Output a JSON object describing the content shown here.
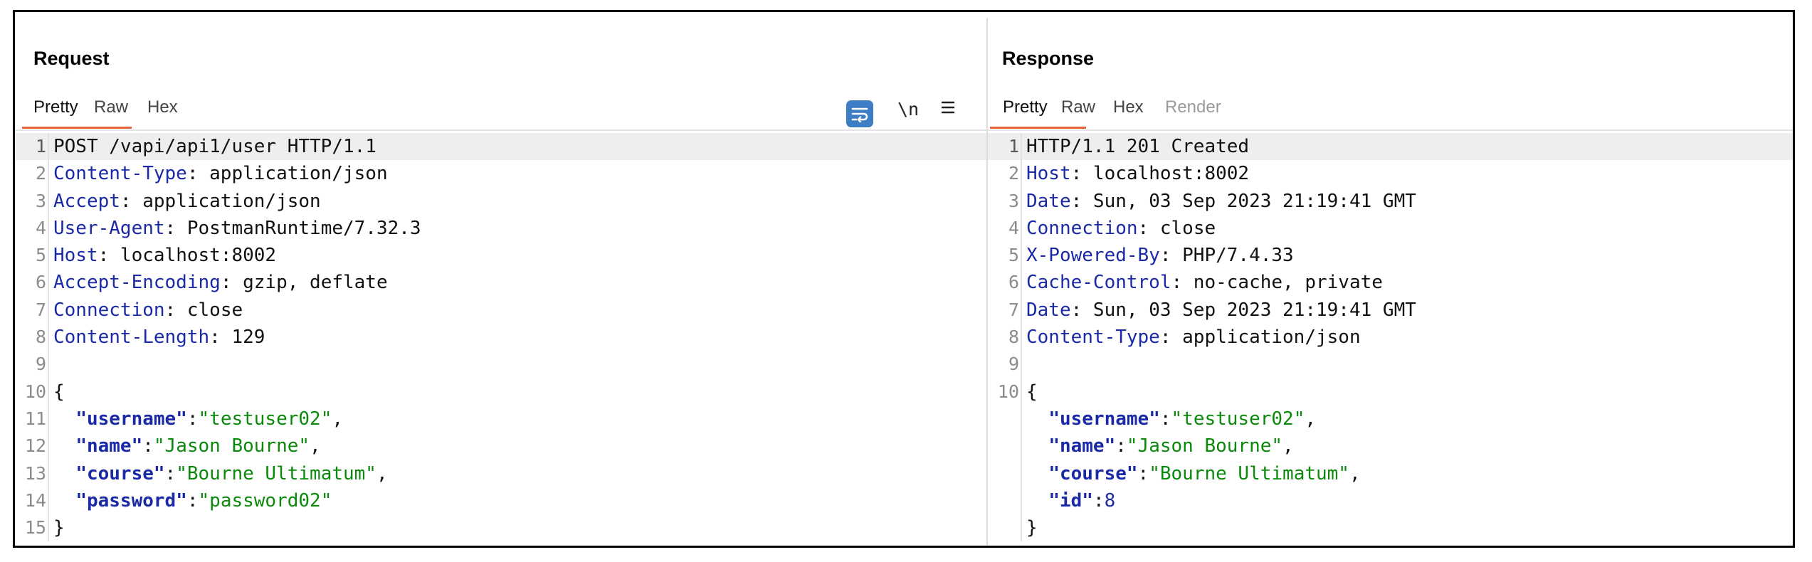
{
  "request": {
    "title": "Request",
    "tabs": [
      "Pretty",
      "Raw",
      "Hex"
    ],
    "active_tab": "Pretty",
    "toolbar": {
      "wrap_icon": "wrap-lines-icon",
      "newline_label": "\\n",
      "menu_icon": "hamburger-menu-icon"
    },
    "lines": [
      {
        "n": "1",
        "parts": [
          [
            "POST /vapi/api1/user HTTP/1.1",
            "plain"
          ]
        ]
      },
      {
        "n": "2",
        "parts": [
          [
            "Content-Type",
            "hk"
          ],
          [
            ": application/json",
            "plain"
          ]
        ]
      },
      {
        "n": "3",
        "parts": [
          [
            "Accept",
            "hk"
          ],
          [
            ": application/json",
            "plain"
          ]
        ]
      },
      {
        "n": "4",
        "parts": [
          [
            "User-Agent",
            "hk"
          ],
          [
            ": PostmanRuntime/7.32.3",
            "plain"
          ]
        ]
      },
      {
        "n": "5",
        "parts": [
          [
            "Host",
            "hk"
          ],
          [
            ": localhost:8002",
            "plain"
          ]
        ]
      },
      {
        "n": "6",
        "parts": [
          [
            "Accept-Encoding",
            "hk"
          ],
          [
            ": gzip, deflate",
            "plain"
          ]
        ]
      },
      {
        "n": "7",
        "parts": [
          [
            "Connection",
            "hk"
          ],
          [
            ": close",
            "plain"
          ]
        ]
      },
      {
        "n": "8",
        "parts": [
          [
            "Content-Length",
            "hk"
          ],
          [
            ": 129",
            "plain"
          ]
        ]
      },
      {
        "n": "9",
        "parts": []
      },
      {
        "n": "10",
        "parts": [
          [
            "{",
            "plain"
          ]
        ]
      },
      {
        "n": "11",
        "parts": [
          [
            "  ",
            "plain"
          ],
          [
            "\"username\"",
            "jk"
          ],
          [
            ":",
            "plain"
          ],
          [
            "\"testuser02\"",
            "js"
          ],
          [
            ",",
            "plain"
          ]
        ]
      },
      {
        "n": "12",
        "parts": [
          [
            "  ",
            "plain"
          ],
          [
            "\"name\"",
            "jk"
          ],
          [
            ":",
            "plain"
          ],
          [
            "\"Jason Bourne\"",
            "js"
          ],
          [
            ",",
            "plain"
          ]
        ]
      },
      {
        "n": "13",
        "parts": [
          [
            "  ",
            "plain"
          ],
          [
            "\"course\"",
            "jk"
          ],
          [
            ":",
            "plain"
          ],
          [
            "\"Bourne Ultimatum\"",
            "js"
          ],
          [
            ",",
            "plain"
          ]
        ]
      },
      {
        "n": "14",
        "parts": [
          [
            "  ",
            "plain"
          ],
          [
            "\"password\"",
            "jk"
          ],
          [
            ":",
            "plain"
          ],
          [
            "\"password02\"",
            "js"
          ]
        ]
      },
      {
        "n": "15",
        "parts": [
          [
            "}",
            "plain"
          ]
        ]
      }
    ]
  },
  "response": {
    "title": "Response",
    "tabs": [
      "Pretty",
      "Raw",
      "Hex",
      "Render"
    ],
    "active_tab": "Pretty",
    "disabled_tabs": [
      "Render"
    ],
    "lines": [
      {
        "n": "1",
        "parts": [
          [
            "HTTP/1.1 201 Created",
            "plain"
          ]
        ]
      },
      {
        "n": "2",
        "parts": [
          [
            "Host",
            "hk"
          ],
          [
            ": localhost:8002",
            "plain"
          ]
        ]
      },
      {
        "n": "3",
        "parts": [
          [
            "Date",
            "hk"
          ],
          [
            ": Sun, 03 Sep 2023 21:19:41 GMT",
            "plain"
          ]
        ]
      },
      {
        "n": "4",
        "parts": [
          [
            "Connection",
            "hk"
          ],
          [
            ": close",
            "plain"
          ]
        ]
      },
      {
        "n": "5",
        "parts": [
          [
            "X-Powered-By",
            "hk"
          ],
          [
            ": PHP/7.4.33",
            "plain"
          ]
        ]
      },
      {
        "n": "6",
        "parts": [
          [
            "Cache-Control",
            "hk"
          ],
          [
            ": no-cache, private",
            "plain"
          ]
        ]
      },
      {
        "n": "7",
        "parts": [
          [
            "Date",
            "hk"
          ],
          [
            ": Sun, 03 Sep 2023 21:19:41 GMT",
            "plain"
          ]
        ]
      },
      {
        "n": "8",
        "parts": [
          [
            "Content-Type",
            "hk"
          ],
          [
            ": application/json",
            "plain"
          ]
        ]
      },
      {
        "n": "9",
        "parts": []
      },
      {
        "n": "10",
        "parts": [
          [
            "{",
            "plain"
          ]
        ]
      },
      {
        "n": "",
        "parts": [
          [
            "  ",
            "plain"
          ],
          [
            "\"username\"",
            "jk"
          ],
          [
            ":",
            "plain"
          ],
          [
            "\"testuser02\"",
            "js"
          ],
          [
            ",",
            "plain"
          ]
        ]
      },
      {
        "n": "",
        "parts": [
          [
            "  ",
            "plain"
          ],
          [
            "\"name\"",
            "jk"
          ],
          [
            ":",
            "plain"
          ],
          [
            "\"Jason Bourne\"",
            "js"
          ],
          [
            ",",
            "plain"
          ]
        ]
      },
      {
        "n": "",
        "parts": [
          [
            "  ",
            "plain"
          ],
          [
            "\"course\"",
            "jk"
          ],
          [
            ":",
            "plain"
          ],
          [
            "\"Bourne Ultimatum\"",
            "js"
          ],
          [
            ",",
            "plain"
          ]
        ]
      },
      {
        "n": "",
        "parts": [
          [
            "  ",
            "plain"
          ],
          [
            "\"id\"",
            "jk"
          ],
          [
            ":",
            "plain"
          ],
          [
            "8",
            "jn"
          ]
        ]
      },
      {
        "n": "",
        "parts": [
          [
            "}",
            "plain"
          ]
        ]
      }
    ]
  },
  "colors": {
    "accent": "#e8653a",
    "header_key": "#1a2aa6",
    "json_string": "#0a8a0a",
    "wrap_button": "#3d7dc4"
  }
}
